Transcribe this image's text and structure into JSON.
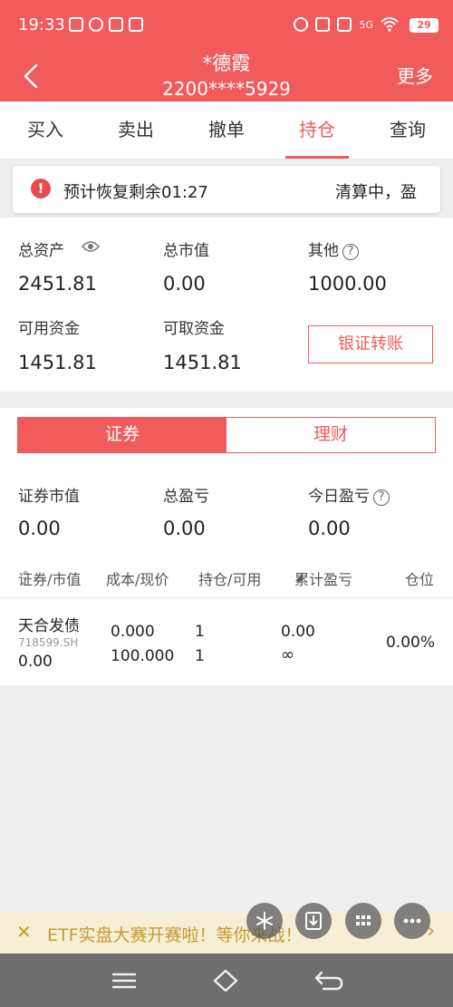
{
  "status_bar": {
    "time": "19:33",
    "signal": "5G",
    "battery": "29"
  },
  "header": {
    "title": "*德霞",
    "account": "2200****5929",
    "more_label": "更多"
  },
  "tabs": [
    {
      "label": "买入"
    },
    {
      "label": "卖出"
    },
    {
      "label": "撤单"
    },
    {
      "label": "持仓"
    },
    {
      "label": "查询"
    }
  ],
  "notice": {
    "text": "预计恢复剩余01:27",
    "status": "清算中，盈"
  },
  "assets": {
    "total_assets_label": "总资产",
    "total_assets": "2451.81",
    "market_value_label": "总市值",
    "market_value": "0.00",
    "other_label": "其他",
    "other": "1000.00",
    "available_label": "可用资金",
    "available": "1451.81",
    "withdrawable_label": "可取资金",
    "withdrawable": "1451.81",
    "transfer_label": "银证转账"
  },
  "segment": {
    "securities": "证券",
    "wealth": "理财"
  },
  "summary": {
    "sec_value_label": "证券市值",
    "sec_value": "0.00",
    "pnl_label": "总盈亏",
    "pnl": "0.00",
    "today_pnl_label": "今日盈亏",
    "today_pnl": "0.00"
  },
  "columns": {
    "security": "证券/市值",
    "cost": "成本/现价",
    "position": "持仓/可用",
    "cum_pnl": "累计盈亏",
    "weight": "仓位"
  },
  "holding": {
    "name": "天合发债",
    "code": "718599.SH",
    "market_value": "0.00",
    "cost": "0.000",
    "price": "100.000",
    "position": "1",
    "available": "1",
    "pnl": "0.00",
    "pnl_ratio": "∞",
    "weight": "0.00%"
  },
  "banner": {
    "text": "ETF实盘大赛开赛啦！等你来战！"
  },
  "colors": {
    "primary": "#f15b5b",
    "banner_text": "#c89a2e"
  }
}
